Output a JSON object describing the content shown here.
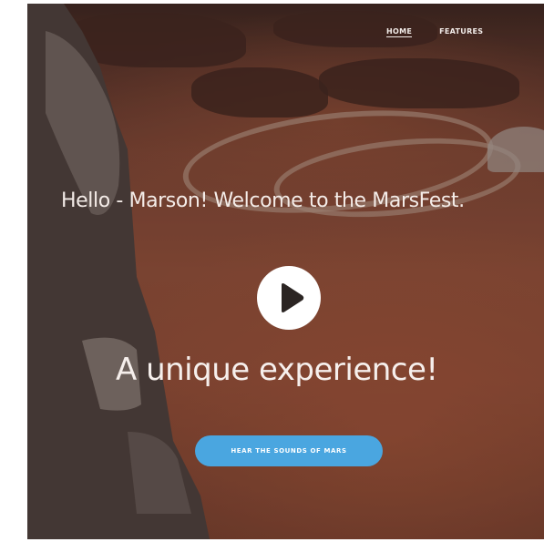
{
  "nav": {
    "items": [
      {
        "label": "HOME",
        "active": true
      },
      {
        "label": "FEATURES",
        "active": false
      }
    ]
  },
  "hero": {
    "headline": "Hello - Marson! Welcome to the MarsFest.",
    "play_icon": "play-icon",
    "tagline": "A unique experience!",
    "cta_label": "HEAR THE SOUNDS OF MARS"
  },
  "colors": {
    "cta": "#4aa6e0",
    "text": "#f4ece8",
    "play_button": "#ffffff",
    "play_glyph": "#2b2523"
  }
}
